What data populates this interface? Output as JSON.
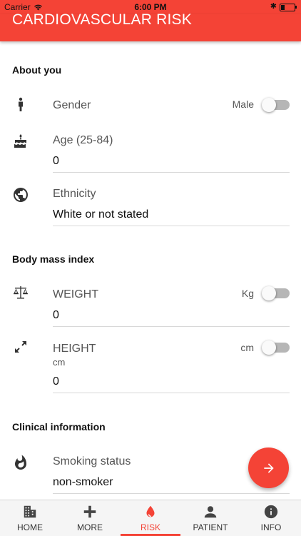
{
  "status_bar": {
    "carrier": "Carrier",
    "time": "6:00 PM"
  },
  "app_bar": {
    "title": "CARDIOVASCULAR RISK"
  },
  "sections": {
    "about": "About you",
    "bmi": "Body mass index",
    "clinical": "Clinical information"
  },
  "fields": {
    "gender": {
      "label": "Gender",
      "toggle_label": "Male",
      "toggle_on": false
    },
    "age": {
      "label": "Age (25-84)",
      "value": "0"
    },
    "ethnicity": {
      "label": "Ethnicity",
      "value": "White or not stated"
    },
    "weight": {
      "label": "WEIGHT",
      "unit": "Kg",
      "toggle_on": false,
      "value": "0"
    },
    "height": {
      "label": "HEIGHT",
      "sub": "cm",
      "unit": "cm",
      "toggle_on": false,
      "value": "0"
    },
    "smoking": {
      "label": "Smoking status",
      "value": "non-smoker"
    }
  },
  "icons": {
    "gender": "person-icon",
    "age": "cake-icon",
    "ethnicity": "globe-icon",
    "weight": "scale-icon",
    "height": "expand-icon",
    "smoking": "flame-icon",
    "fab": "arrow-forward-icon"
  },
  "nav": [
    {
      "label": "HOME",
      "icon": "building-icon",
      "active": false
    },
    {
      "label": "MORE",
      "icon": "plus-icon",
      "active": false
    },
    {
      "label": "RISK",
      "icon": "drop-icon",
      "active": true
    },
    {
      "label": "PATIENT",
      "icon": "person-icon",
      "active": false
    },
    {
      "label": "INFO",
      "icon": "info-icon",
      "active": false
    }
  ],
  "colors": {
    "accent": "#f44336",
    "toggle_track": "#b6b6b6"
  }
}
